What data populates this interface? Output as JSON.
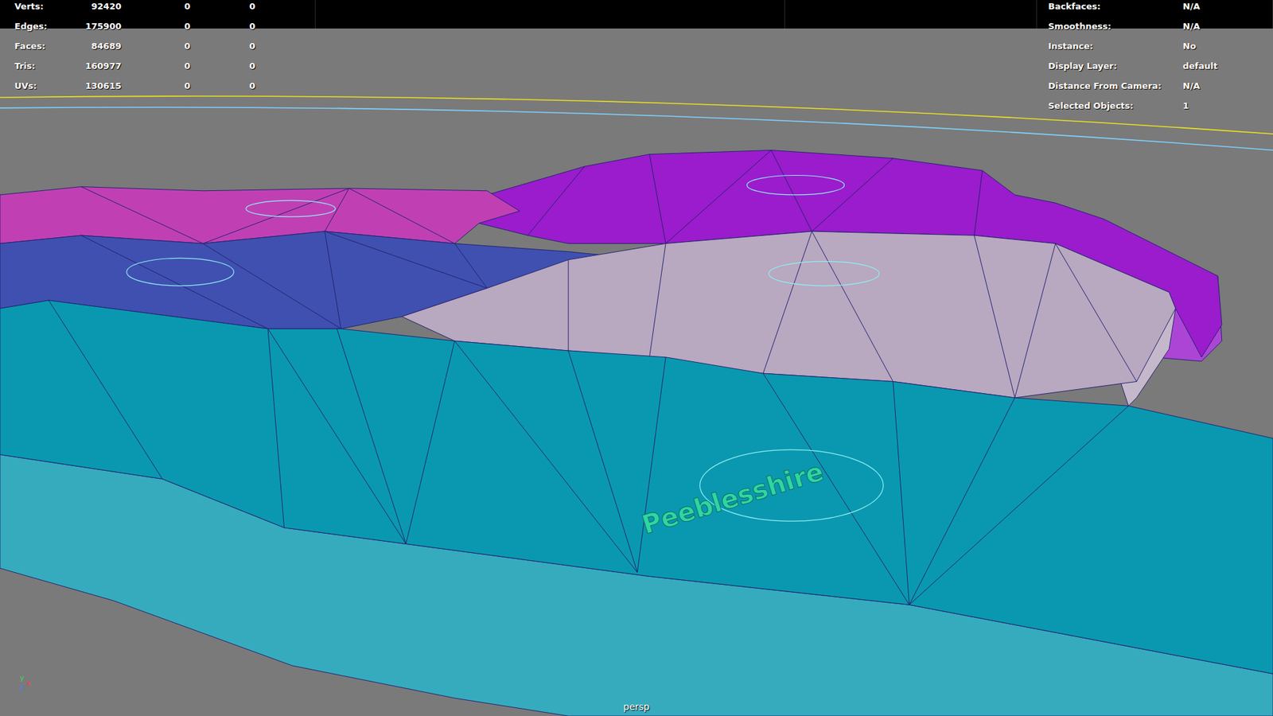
{
  "hud": {
    "stats": [
      {
        "label": "Verts:",
        "values": [
          "92420",
          "0",
          "0"
        ]
      },
      {
        "label": "Edges:",
        "values": [
          "175900",
          "0",
          "0"
        ]
      },
      {
        "label": "Faces:",
        "values": [
          "84689",
          "0",
          "0"
        ]
      },
      {
        "label": "Tris:",
        "values": [
          "160977",
          "0",
          "0"
        ]
      },
      {
        "label": "UVs:",
        "values": [
          "130615",
          "0",
          "0"
        ]
      }
    ],
    "info": [
      {
        "label": "Backfaces:",
        "value": "N/A"
      },
      {
        "label": "Smoothness:",
        "value": "N/A"
      },
      {
        "label": "Instance:",
        "value": "No"
      },
      {
        "label": "Display Layer:",
        "value": "default"
      },
      {
        "label": "Distance From Camera:",
        "value": "N/A"
      },
      {
        "label": "Selected Objects:",
        "value": "1"
      }
    ]
  },
  "scene": {
    "regions": [
      {
        "color": "#9a1ccc"
      },
      {
        "color": "#c040b4"
      },
      {
        "color": "#4050b0"
      },
      {
        "color": "#b8a8c0"
      },
      {
        "color": "#0a98b0",
        "label": "Peeblesshire"
      }
    ]
  },
  "axis": [
    "y",
    "z",
    "x"
  ],
  "viewport": {
    "camera": "persp"
  }
}
